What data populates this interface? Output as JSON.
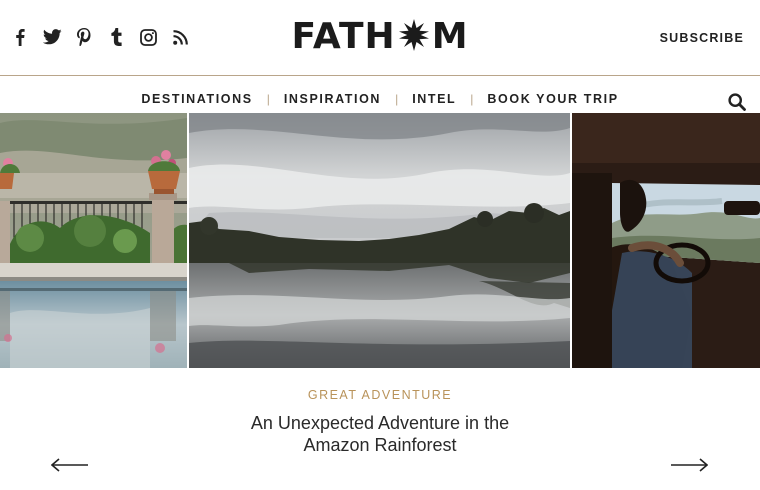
{
  "header": {
    "logo": {
      "text_before": "FATH",
      "text_after": "M"
    },
    "subscribe_label": "SUBSCRIBE",
    "social_icons": [
      "facebook-icon",
      "twitter-icon",
      "pinterest-icon",
      "tumblr-icon",
      "instagram-icon",
      "rss-icon"
    ]
  },
  "nav": {
    "items": [
      {
        "label": "DESTINATIONS"
      },
      {
        "label": "INSPIRATION"
      },
      {
        "label": "INTEL"
      },
      {
        "label": "BOOK YOUR TRIP"
      }
    ],
    "separator": "|"
  },
  "feature": {
    "category": "GREAT ADVENTURE",
    "title": "An Unexpected Adventure in the Amazon Rainforest"
  },
  "colors": {
    "accent": "#b9935a",
    "rule": "#b9a58a",
    "text": "#222222"
  }
}
